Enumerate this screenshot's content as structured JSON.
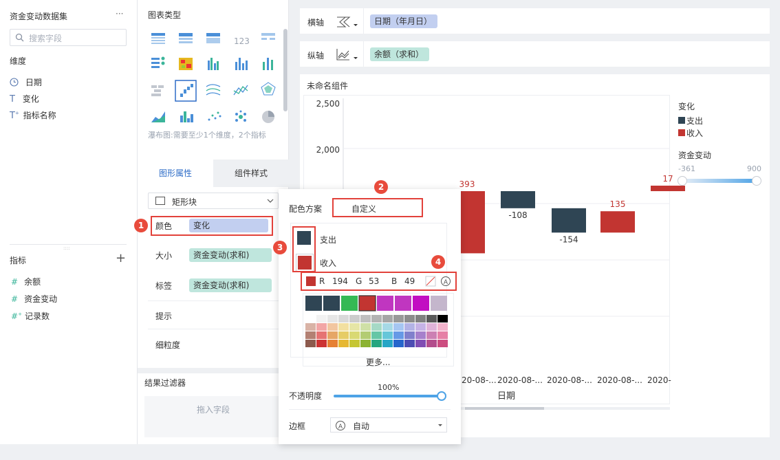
{
  "dataset": {
    "title": "资金变动数据集",
    "more": "···",
    "search_placeholder": "搜索字段"
  },
  "dims": {
    "title": "维度",
    "items": [
      {
        "icon": "clock-icon",
        "label": "日期"
      },
      {
        "icon": "text-icon",
        "label": "变化"
      },
      {
        "icon": "text-plus-icon",
        "label": "指标名称"
      }
    ]
  },
  "measures": {
    "title": "指标",
    "add": "+",
    "items": [
      {
        "icon": "hash-icon",
        "label": "余额"
      },
      {
        "icon": "hash-icon",
        "label": "资金变动"
      },
      {
        "icon": "hash-plus-icon",
        "label": "记录数"
      }
    ]
  },
  "chart_types": {
    "title": "图表类型",
    "hint": "瀑布图:需要至少1个维度，2个指标"
  },
  "tabs": {
    "active": "图形属性",
    "other": "组件样式"
  },
  "props": {
    "shape": "矩形块",
    "color_label": "颜色",
    "color_value": "变化",
    "size_label": "大小",
    "size_value": "资金变动(求和)",
    "tag_label": "标签",
    "tag_value": "资金变动(求和)",
    "tip_label": "提示",
    "grain_label": "细粒度"
  },
  "filter": {
    "title": "结果过滤器",
    "drop": "拖入字段"
  },
  "axes": {
    "x_label": "横轴",
    "x_value": "日期（年月日）",
    "y_label": "纵轴",
    "y_value": "余额（求和）"
  },
  "widget": {
    "title": "未命名组件"
  },
  "popup": {
    "scheme_label": "配色方案",
    "scheme_value": "自定义",
    "items": [
      "支出",
      "收入"
    ],
    "r_label": "R",
    "r": "194",
    "g_label": "G",
    "g": "53",
    "b_label": "B",
    "b": "49",
    "more": "更多...",
    "opacity_label": "不透明度",
    "opacity_value": "100%",
    "border_label": "边框",
    "border_value": "自动"
  },
  "legend": {
    "title": "变化",
    "items": [
      "支出",
      "收入"
    ],
    "range_title": "资金变动",
    "range_min": "-361",
    "range_max": "900"
  },
  "annotations": [
    "1",
    "2",
    "3",
    "4"
  ],
  "colors": {
    "expense": "#2f4554",
    "income": "#c23531",
    "accent": "#4ea3e6"
  },
  "chart_data": {
    "type": "bar",
    "subtype": "waterfall",
    "yticks": [
      "2,500",
      "2,000"
    ],
    "xticks": [
      "20-08-...",
      "2020-08-...",
      "2020-08-...",
      "2020-08-...",
      "2020-"
    ],
    "xlabel": "日期",
    "bars": [
      {
        "series": "收入",
        "value": 393
      },
      {
        "series": "支出",
        "value": -108
      },
      {
        "series": "支出",
        "value": -154
      },
      {
        "series": "收入",
        "value": 135
      },
      {
        "series": "收入",
        "value": 17
      }
    ],
    "data_labels": [
      "393",
      "-108",
      "-154",
      "135",
      "17"
    ]
  }
}
